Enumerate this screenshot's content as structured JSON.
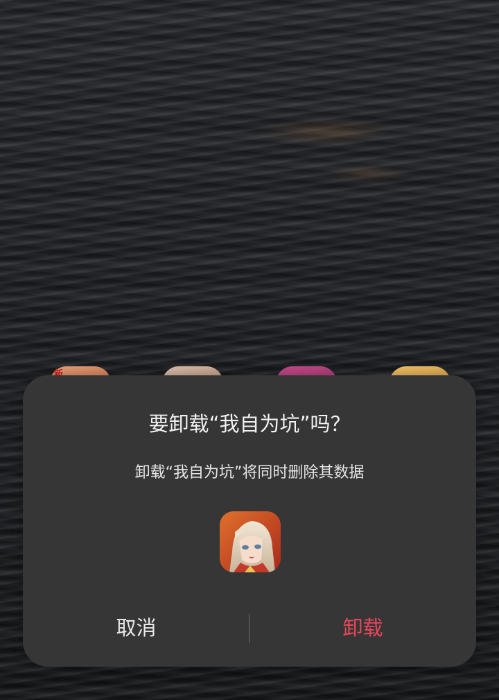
{
  "background": {
    "peek_icon_badge": "新"
  },
  "dialog": {
    "title": "要卸载“我自为坑”吗？",
    "message": "卸载“我自为坑”将同时删除其数据",
    "app_icon": "anime-character-game-icon",
    "cancel_label": "取消",
    "uninstall_label": "卸载"
  },
  "colors": {
    "dialog_bg": "#363636",
    "uninstall_accent": "#e8485a",
    "text_primary": "#f2f2f2"
  }
}
